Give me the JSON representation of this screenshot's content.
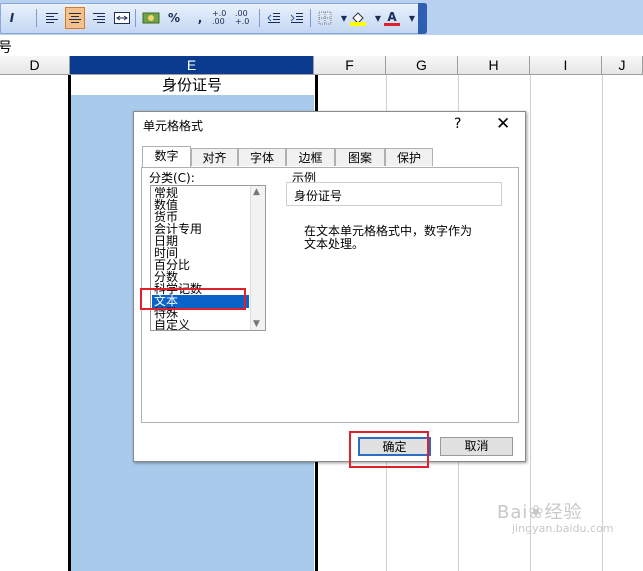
{
  "toolbar": {
    "italic_glyph": "I",
    "percent_label": "%",
    "comma_label": ",",
    "increase_decimal_label": "+.0 .00",
    "decrease_decimal_label": ".00 +.0",
    "font_color_label": "A"
  },
  "formula_bar": {
    "cell_text": "号"
  },
  "columns": [
    "D",
    "E",
    "F",
    "G",
    "H",
    "I",
    "J"
  ],
  "cells": {
    "E1": "身份证号"
  },
  "dialog": {
    "title": "单元格格式",
    "help": "?",
    "close": "✕",
    "tabs": [
      "数字",
      "对齐",
      "字体",
      "边框",
      "图案",
      "保护"
    ],
    "active_tab": "数字",
    "category_label": "分类(C):",
    "categories": [
      "常规",
      "数值",
      "货币",
      "会计专用",
      "日期",
      "时间",
      "百分比",
      "分数",
      "科学记数",
      "文本",
      "特殊",
      "自定义"
    ],
    "selected_category": "文本",
    "sample_label": "示例",
    "sample_value": "身份证号",
    "description_line1": "在文本单元格格式中，数字作为",
    "description_line2": "文本处理。",
    "ok": "确定",
    "cancel": "取消"
  },
  "colors": {
    "selection": "#a9cbeb",
    "header_selected": "#0a3b8f",
    "highlight": "#e0202a",
    "list_selected": "#0a63c9"
  }
}
